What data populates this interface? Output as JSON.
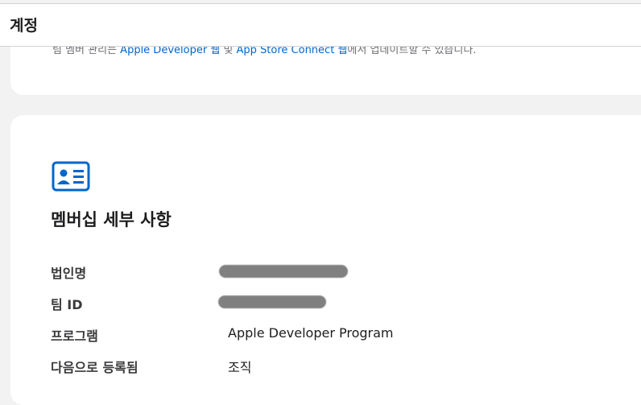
{
  "header": {
    "title": "계정"
  },
  "top_card": {
    "line_prefix": "팀 멤버 관리는",
    "link1": "Apple Developer 웹",
    "middle": "및",
    "link2": "App Store Connect 웹",
    "suffix": "에서 업데이트할 수 있습니다."
  },
  "membership": {
    "icon": "contact-card-icon",
    "title": "멤버십 세부 사항",
    "rows": [
      {
        "label": "법인명",
        "value": ""
      },
      {
        "label": "팀 ID",
        "value": ""
      },
      {
        "label": "프로그램",
        "value": "Apple Developer Program"
      },
      {
        "label": "다음으로 등록됨",
        "value": "조직"
      }
    ]
  },
  "colors": {
    "accent": "#0066cc",
    "redaction": "#808080",
    "background": "#f2f2f3"
  }
}
